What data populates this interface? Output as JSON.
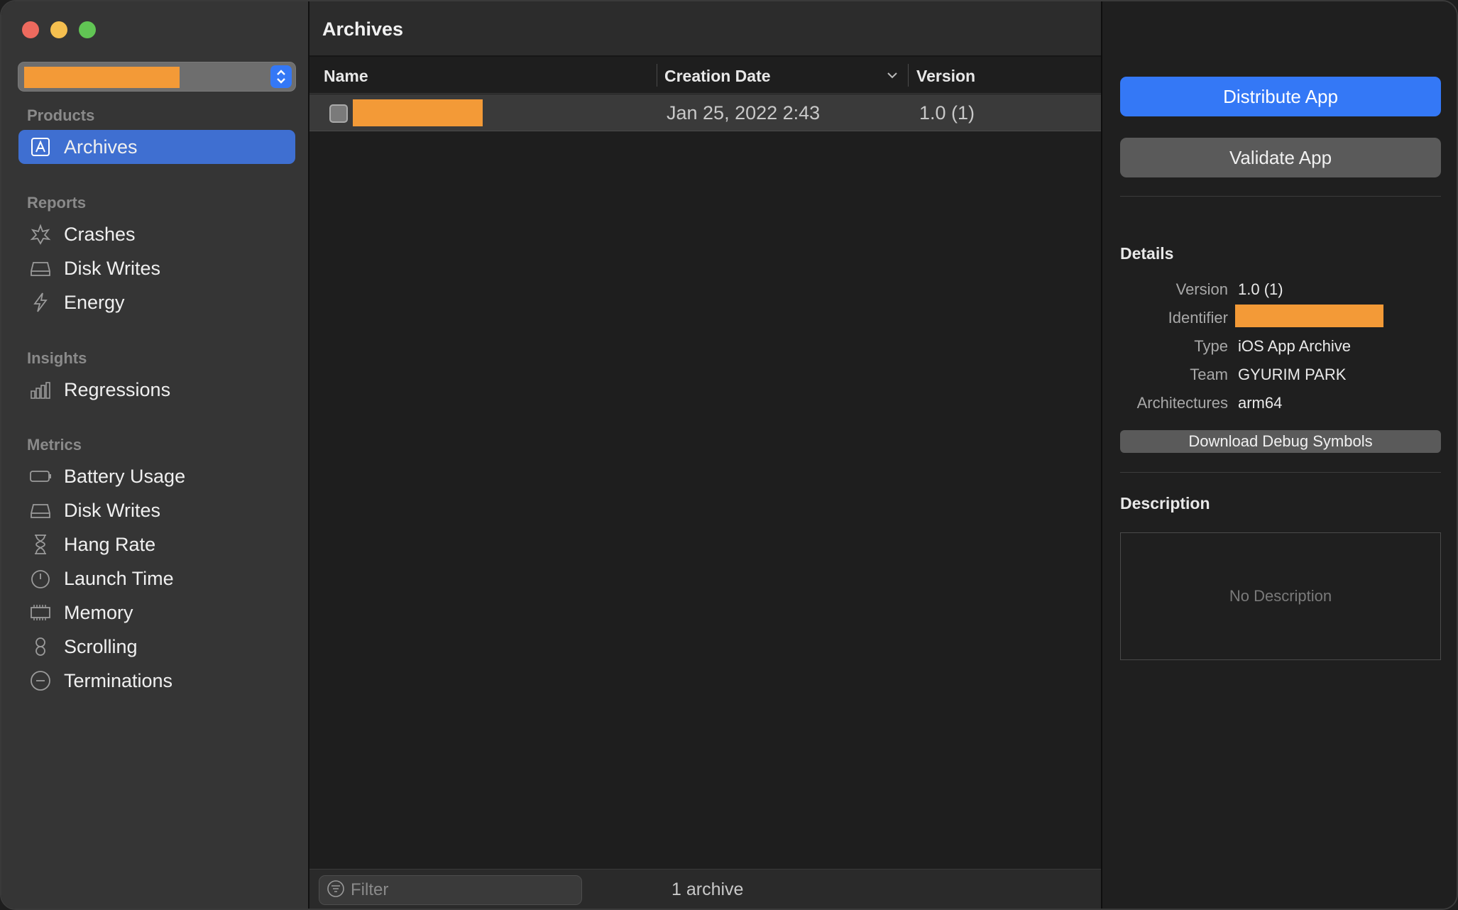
{
  "sidebar": {
    "product_selector_value": "",
    "sections": {
      "products": "Products",
      "reports": "Reports",
      "insights": "Insights",
      "metrics": "Metrics"
    },
    "items": {
      "archives": "Archives",
      "crashes": "Crashes",
      "disk_writes_report": "Disk Writes",
      "energy": "Energy",
      "regressions": "Regressions",
      "battery_usage": "Battery Usage",
      "disk_writes_metric": "Disk Writes",
      "hang_rate": "Hang Rate",
      "launch_time": "Launch Time",
      "memory": "Memory",
      "scrolling": "Scrolling",
      "terminations": "Terminations"
    }
  },
  "main": {
    "title": "Archives",
    "columns": {
      "name": "Name",
      "creation_date": "Creation Date",
      "version": "Version"
    },
    "rows": [
      {
        "name": "",
        "creation_date": "Jan 25, 2022 2:43",
        "version": "1.0 (1)"
      }
    ],
    "filter_placeholder": "Filter",
    "count": "1 archive"
  },
  "inspector": {
    "distribute_label": "Distribute App",
    "validate_label": "Validate App",
    "details_heading": "Details",
    "details": {
      "version_label": "Version",
      "version_value": "1.0 (1)",
      "identifier_label": "Identifier",
      "identifier_value": "",
      "type_label": "Type",
      "type_value": "iOS App Archive",
      "team_label": "Team",
      "team_value": "GYURIM PARK",
      "arch_label": "Architectures",
      "arch_value": "arm64"
    },
    "download_symbols_label": "Download Debug Symbols",
    "description_heading": "Description",
    "description_placeholder": "No Description"
  },
  "colors": {
    "accent": "#3478f6",
    "selection": "#3f6fd1",
    "redaction": "#f39a37"
  }
}
